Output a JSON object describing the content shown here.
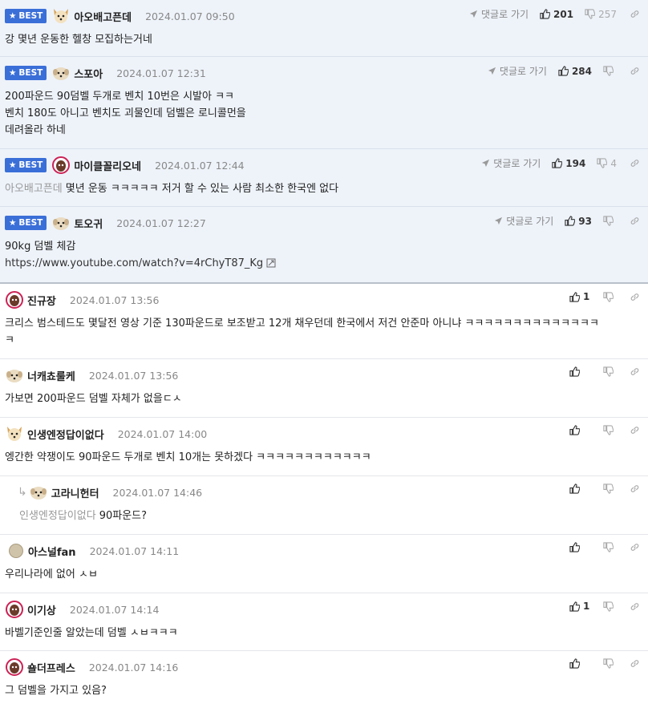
{
  "labels": {
    "best": "BEST",
    "reply_to": "댓글로 가기"
  },
  "colors": {
    "best_badge": "#3a6fd8",
    "best_bg": "#eef3fa"
  },
  "comments": [
    {
      "best": true,
      "author": "아오배고픈데",
      "date": "2024.01.07 09:50",
      "show_reply": true,
      "up": "201",
      "down": "257",
      "text": "강 몇년 운동한 헬창 모집하는거네"
    },
    {
      "best": true,
      "author": "스포아",
      "date": "2024.01.07 12:31",
      "show_reply": true,
      "up": "284",
      "down": "",
      "text": "200파운드 90덤벨 두개로 벤치 10번은 시발아 ㅋㅋ\n벤치 180도 아니고 벤치도 괴물인데 덤벨은 로니콜먼을\n데려올라 하네"
    },
    {
      "best": true,
      "author": "마이클꼴리오네",
      "date": "2024.01.07 12:44",
      "show_reply": true,
      "up": "194",
      "down": "4",
      "mention": "아오배고픈데",
      "text": "몇년 운동 ㅋㅋㅋㅋㅋ 저거 할 수 있는 사람 최소한 한국엔 없다"
    },
    {
      "best": true,
      "author": "토오귀",
      "date": "2024.01.07 12:27",
      "show_reply": true,
      "up": "93",
      "down": "",
      "text": "90kg 덤벨 체감",
      "link": "https://www.youtube.com/watch?v=4rChyT87_Kg"
    },
    {
      "best": false,
      "author": "진규장",
      "date": "2024.01.07 13:56",
      "up": "1",
      "down": "",
      "text": "크리스 범스테드도 몇달전 영상 기준 130파운드로 보조받고 12개 채우던데 한국에서 저건 안준마 아니냐 ㅋㅋㅋㅋㅋㅋㅋㅋㅋㅋㅋㅋㅋㅋ\nㅋ"
    },
    {
      "best": false,
      "author": "너캐쵸룰케",
      "date": "2024.01.07 13:56",
      "up": "",
      "down": "",
      "text": "가보면 200파운드 덤벨 자체가 없을ㄷㅅ"
    },
    {
      "best": false,
      "author": "인생엔정답이없다",
      "date": "2024.01.07 14:00",
      "up": "",
      "down": "",
      "text": "엥간한 약쟁이도 90파운드 두개로 벤치 10개는 못하겠다 ㅋㅋㅋㅋㅋㅋㅋㅋㅋㅋㅋㅋ"
    },
    {
      "best": false,
      "reply": true,
      "author": "고라니헌터",
      "date": "2024.01.07 14:46",
      "up": "",
      "down": "",
      "mention": "인생엔정답이없다",
      "text": "90파운드?"
    },
    {
      "best": false,
      "author": "아스널fan",
      "date": "2024.01.07 14:11",
      "up": "",
      "down": "",
      "text": "우리나라에 없어 ㅅㅂ"
    },
    {
      "best": false,
      "author": "이기상",
      "date": "2024.01.07 14:14",
      "up": "1",
      "down": "",
      "text": "바벨기준인줄 알았는데 덤벨 ㅅㅂㅋㅋㅋ"
    },
    {
      "best": false,
      "author": "숄더프레스",
      "date": "2024.01.07 14:16",
      "up": "",
      "down": "",
      "text": "그 덤벨을 가지고 있음?"
    }
  ]
}
